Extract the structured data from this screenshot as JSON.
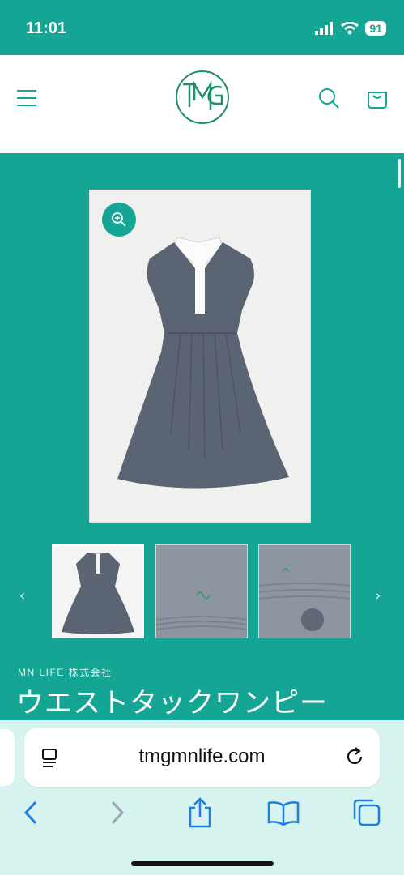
{
  "status_bar": {
    "time": "11:01",
    "battery": "91"
  },
  "header": {
    "logo_text": "TMG"
  },
  "product": {
    "brand": "MN LIFE 株式会社",
    "title": "ウエストタックワンピー"
  },
  "browser": {
    "url": "tmgmnlife.com"
  },
  "icons": {
    "menu": "menu-icon",
    "search": "search-icon",
    "cart": "cart-icon",
    "zoom": "zoom-icon",
    "reader": "reader-icon",
    "reload": "reload-icon",
    "back": "back-icon",
    "forward": "forward-icon",
    "share": "share-icon",
    "bookmarks": "bookmarks-icon",
    "tabs": "tabs-icon"
  },
  "colors": {
    "accent": "#14a595",
    "browser_bar": "#d7f3f0",
    "dress": "#5b6472"
  }
}
